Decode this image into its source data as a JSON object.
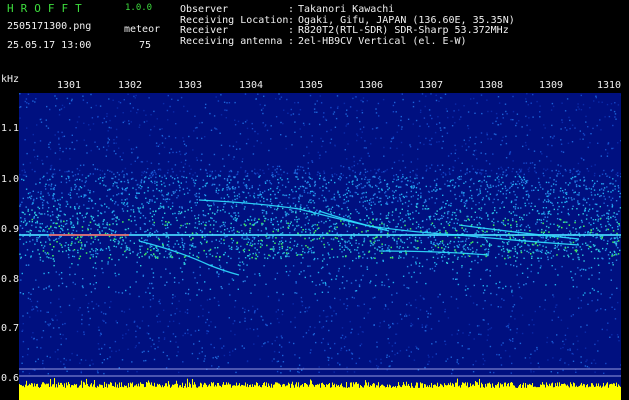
{
  "header": {
    "app_name": "HROFFT",
    "version": "1.0.0",
    "filename": "2505171300.png",
    "datetime": "25.05.17 13:00",
    "meteor_label": "meteor",
    "meteor_count": "75"
  },
  "info": [
    {
      "key": "Observer",
      "value": "Takanori Kawachi"
    },
    {
      "key": "Receiving Location",
      "value": "Ogaki, Gifu, JAPAN (136.60E, 35.35N)"
    },
    {
      "key": "Receiver",
      "value": "R820T2(RTL-SDR) SDR-Sharp 53.372MHz"
    },
    {
      "key": "Receiving antenna",
      "value": "2el-HB9CV Vertical (el. E-W)"
    }
  ],
  "axis": {
    "unit": "kHz",
    "x_ticks": [
      "1301",
      "1302",
      "1303",
      "1304",
      "1305",
      "1306",
      "1307",
      "1308",
      "1309",
      "1310"
    ],
    "y_ticks": [
      "1.1",
      "1.0",
      "0.9",
      "0.8",
      "0.7",
      "0.6"
    ]
  },
  "colors": {
    "title_green": "#3ddc3d",
    "background_blue": "#001080",
    "signal_line": "#00e0ff",
    "carrier_red": "#ff5050",
    "power_bar": "#ffff00"
  }
}
